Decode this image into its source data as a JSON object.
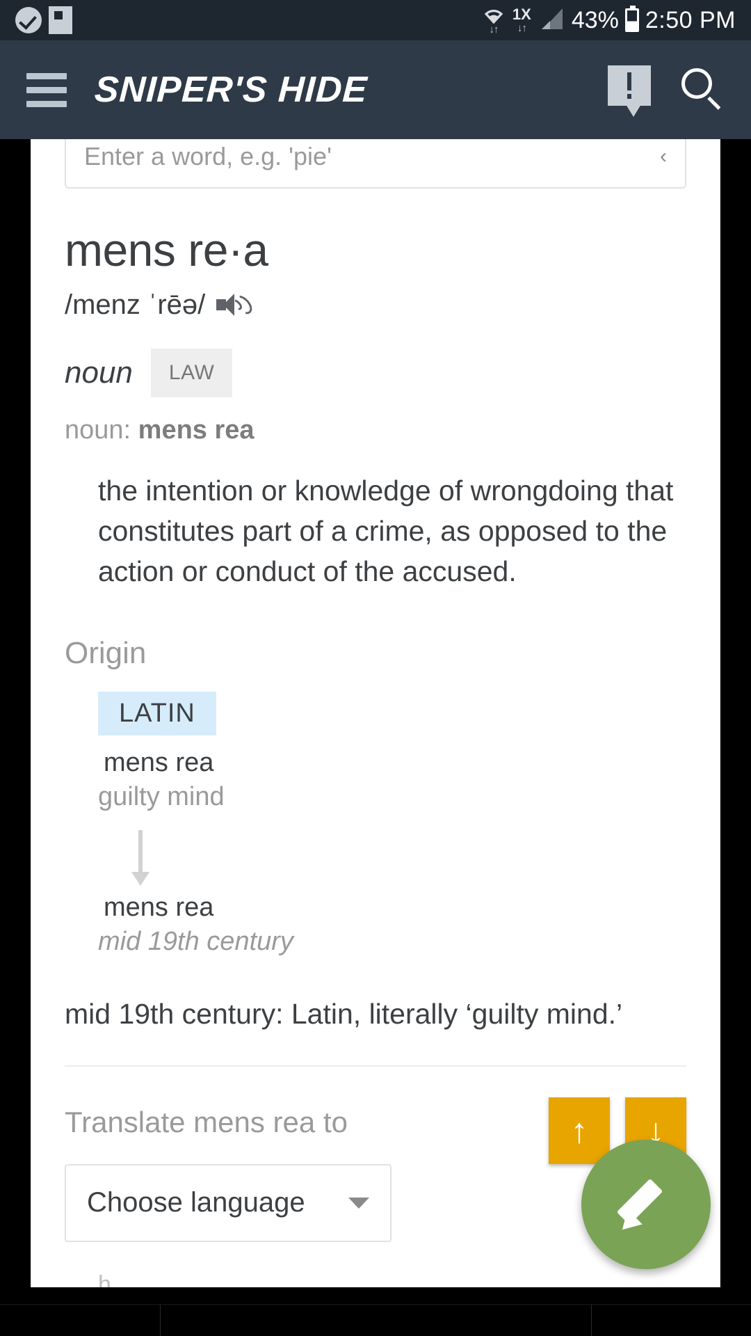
{
  "statusbar": {
    "icons_left": [
      "check-circle-icon",
      "flipboard-icon"
    ],
    "network_label": "1X",
    "battery_percent": "43%",
    "time": "2:50 PM"
  },
  "appbar": {
    "menu_icon": "hamburger-menu-icon",
    "brand": "SNIPER'S HIDE",
    "alert_icon": "alert-message-icon",
    "search_icon": "search-icon"
  },
  "search": {
    "placeholder": "Enter a word, e.g. 'pie'",
    "value": "",
    "chevron": "‹"
  },
  "entry": {
    "headword": "mens re·a",
    "pronunciation": "/menz ˈrēə/",
    "speaker_icon": "speaker-icon",
    "part_of_speech": "noun",
    "register_tag": "LAW",
    "sense_label_prefix": "noun: ",
    "sense_label_word": "mens rea",
    "definitions": [
      "the intention or knowledge of wrongdoing that constitutes part of a crime, as opposed to the action or conduct of the accused."
    ]
  },
  "origin": {
    "heading": "Origin",
    "language_chip": "LATIN",
    "source_word": "mens rea",
    "source_gloss": "guilty mind",
    "arrow_icon": "down-arrow-icon",
    "result_word": "mens rea",
    "result_era": "mid 19th century",
    "etymology_text": "mid 19th century: Latin, literally ‘guilty mind.’"
  },
  "translate": {
    "label": "Translate mens rea to",
    "select_value": "Choose language",
    "up_button": "↑",
    "down_button": "↓",
    "up_button_name": "scroll-up-button",
    "down_button_name": "scroll-down-button",
    "trailing_text": "h"
  },
  "fab": {
    "icon": "edit-pencil-icon"
  },
  "colors": {
    "status_bg": "#1e2630",
    "appbar_bg": "#2e3a47",
    "accent_orange": "#e8a500",
    "fab_green": "#7aa356",
    "latin_chip": "#d6ecfb",
    "tag_gray": "#eeeeee"
  }
}
